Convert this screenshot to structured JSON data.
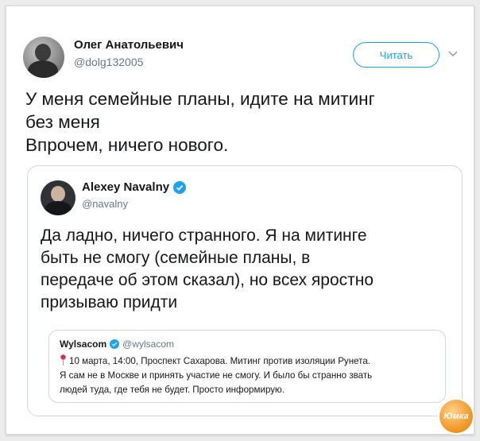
{
  "tweet": {
    "author_name": "Олег Анатольевич",
    "author_handle": "@dolg132005",
    "follow_label": "Читать",
    "text_lines": [
      "У меня семейные планы, идите на митинг",
      "без меня",
      "Впрочем, ничего нового."
    ]
  },
  "quoted": {
    "author_name": "Alexey Navalny",
    "author_handle": "@navalny",
    "text_lines": [
      "Да ладно, ничего странного. Я на митинге",
      "быть не смогу (семейные планы, в",
      "передаче об этом сказал), но всех яростно",
      "призываю придти"
    ],
    "nested": {
      "author_name": "Wylsacom",
      "author_handle": "@wylsacom",
      "text_lines": [
        "10 марта, 14:00, Проспект Сахарова. Митинг против изоляции Рунета.",
        "Я сам не в Москве и принять участие не смогу. И было бы странно звать",
        "людей туда, где тебя не будет. Просто информирую."
      ]
    }
  },
  "watermark": {
    "text": "Юмка"
  },
  "colors": {
    "accent": "#1da1f2",
    "text": "#14171a",
    "secondary": "#657786"
  }
}
